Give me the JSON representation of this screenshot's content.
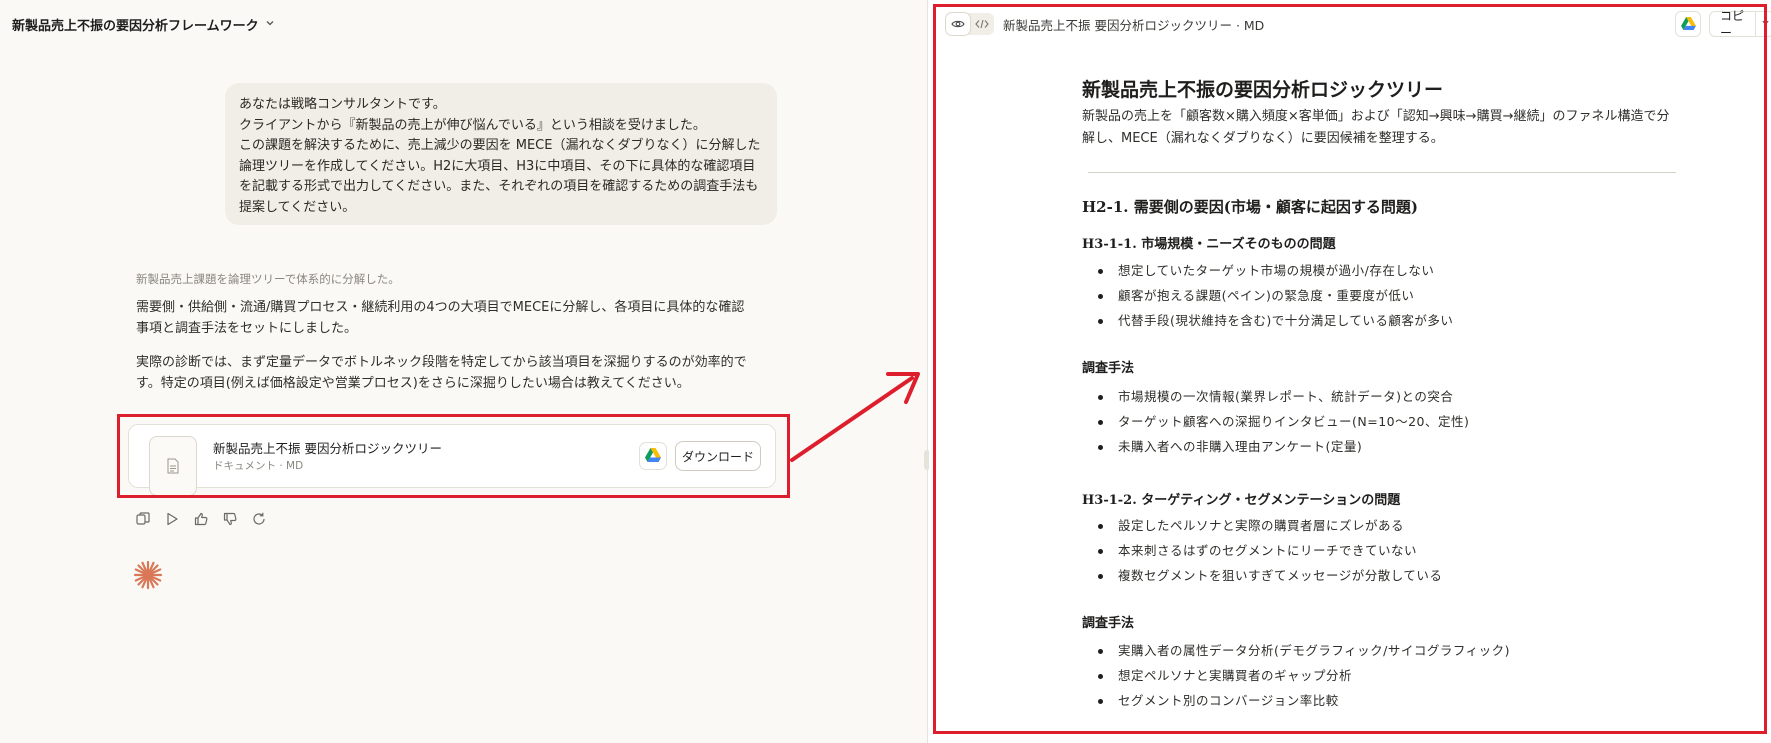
{
  "chat": {
    "title": "新製品売上不振の要因分析フレームワーク",
    "user_message": "あなたは戦略コンサルタントです。\nクライアントから『新製品の売上が伸び悩んでいる』という相談を受けました。\nこの課題を解決するために、売上減少の要因を MECE（漏れなくダブりなく）に分解した論理ツリーを作成してください。H2に大項目、H3に中項目、その下に具体的な確認項目を記載する形式で出力してください。また、それぞれの項目を確認するための調査手法も提案してください。",
    "summary": "新製品売上課題を論理ツリーで体系的に分解した。",
    "para1": "需要側・供給側・流通/購買プロセス・継続利用の4つの大項目でMECEに分解し、各項目に具体的な確認事項と調査手法をセットにしました。",
    "para2": "実際の診断では、まず定量データでボトルネック段階を特定してから該当項目を深掘りするのが効率的です。特定の項目(例えば価格設定や営業プロセス)をさらに深掘りしたい場合は教えてください。",
    "file": {
      "title": "新製品売上不振 要因分析ロジックツリー",
      "subtitle": "ドキュメント · MD",
      "download_label": "ダウンロード"
    }
  },
  "viewer": {
    "title": "新製品売上不振 要因分析ロジックツリー · MD",
    "copy_label": "コピー"
  },
  "doc": {
    "h1": "新製品売上不振の要因分析ロジックツリー",
    "intro": "新製品の売上を「顧客数×購入頻度×客単価」および「認知→興味→購買→継続」のファネル構造で分解し、MECE（漏れなくダブりなく）に要因候補を整理する。",
    "h2_1": "H2-1. 需要側の要因(市場・顧客に起因する問題)",
    "h3_1": "H3-1-1. 市場規模・ニーズそのものの問題",
    "list_1": [
      "想定していたターゲット市場の規模が過小/存在しない",
      "顧客が抱える課題(ペイン)の緊急度・重要度が低い",
      "代替手段(現状維持を含む)で十分満足している顧客が多い"
    ],
    "method_label_1": "調査手法",
    "list_2": [
      "市場規模の一次情報(業界レポート、統計データ)との突合",
      "ターゲット顧客への深掘りインタビュー(N=10〜20、定性)",
      "未購入者への非購入理由アンケート(定量)"
    ],
    "h3_2": "H3-1-2. ターゲティング・セグメンテーションの問題",
    "list_3": [
      "設定したペルソナと実際の購買者層にズレがある",
      "本来刺さるはずのセグメントにリーチできていない",
      "複数セグメントを狙いすぎてメッセージが分散している"
    ],
    "method_label_2": "調査手法",
    "list_4": [
      "実購入者の属性データ分析(デモグラフィック/サイコグラフィック)",
      "想定ペルソナと実購買者のギャップ分析",
      "セグメント別のコンバージョン率比較"
    ]
  }
}
